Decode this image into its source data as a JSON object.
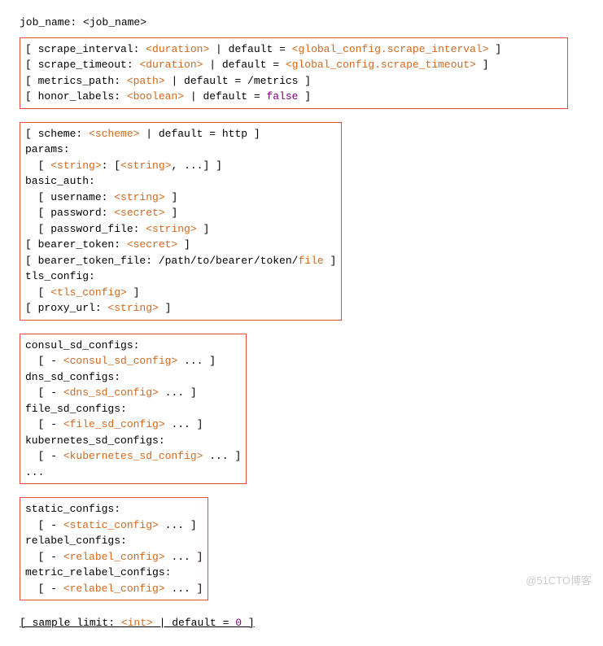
{
  "top": {
    "line": "job_name: <job_name>"
  },
  "block1": {
    "l1_a": "[ scrape_interval: ",
    "l1_b": "<duration>",
    "l1_c": " | default = ",
    "l1_d": "<global_config.scrape_interval>",
    "l1_e": " ]",
    "l2_a": "[ scrape_timeout: ",
    "l2_b": "<duration>",
    "l2_c": " | default = ",
    "l2_d": "<global_config.scrape_timeout>",
    "l2_e": " ]",
    "l3_a": "[ metrics_path: ",
    "l3_b": "<path>",
    "l3_c": " | default = /metrics ]",
    "l4_a": "[ honor_labels: ",
    "l4_b": "<boolean>",
    "l4_c": " | default = ",
    "l4_d": "false",
    "l4_e": " ]"
  },
  "block2": {
    "l1_a": "[ scheme: ",
    "l1_b": "<scheme>",
    "l1_c": " | default = http ]",
    "l2": "params:",
    "l3_a": "  [ ",
    "l3_b": "<string>",
    "l3_c": ": [",
    "l3_d": "<string>",
    "l3_e": ", ...] ]",
    "l4": "basic_auth:",
    "l5_a": "  [ username: ",
    "l5_b": "<string>",
    "l5_c": " ]",
    "l6_a": "  [ password: ",
    "l6_b": "<secret>",
    "l6_c": " ]",
    "l7_a": "  [ password_file: ",
    "l7_b": "<string>",
    "l7_c": " ]",
    "l8_a": "[ bearer_token: ",
    "l8_b": "<secret>",
    "l8_c": " ]",
    "l9_a": "[ bearer_token_file: /path/to/bearer/token/",
    "l9_b": "file",
    "l9_c": " ]",
    "l10": "tls_config:",
    "l11_a": "  [ ",
    "l11_b": "<tls_config>",
    "l11_c": " ]",
    "l12_a": "[ proxy_url: ",
    "l12_b": "<string>",
    "l12_c": " ]"
  },
  "block3": {
    "l1": "consul_sd_configs:",
    "l2_a": "  [ - ",
    "l2_b": "<consul_sd_config>",
    "l2_c": " ... ]",
    "l3": "dns_sd_configs:",
    "l4_a": "  [ - ",
    "l4_b": "<dns_sd_config>",
    "l4_c": " ... ]",
    "l5": "file_sd_configs:",
    "l6_a": "  [ - ",
    "l6_b": "<file_sd_config>",
    "l6_c": " ... ]",
    "l7": "kubernetes_sd_configs:",
    "l8_a": "  [ - ",
    "l8_b": "<kubernetes_sd_config>",
    "l8_c": " ... ]",
    "l9": "..."
  },
  "block4": {
    "l1": "static_configs:",
    "l2_a": "  [ - ",
    "l2_b": "<static_config>",
    "l2_c": " ... ]",
    "l3": "relabel_configs:",
    "l4_a": "  [ - ",
    "l4_b": "<relabel_config>",
    "l4_c": " ... ]",
    "l5": "metric_relabel_configs:",
    "l6_a": "  [ - ",
    "l6_b": "<relabel_config>",
    "l6_c": " ... ]"
  },
  "bottom": {
    "l1_a": "[ sample_limit: ",
    "l1_b": "<int>",
    "l1_c": " | default = ",
    "l1_d": "0",
    "l1_e": " ]"
  },
  "watermark": "@51CTO博客"
}
